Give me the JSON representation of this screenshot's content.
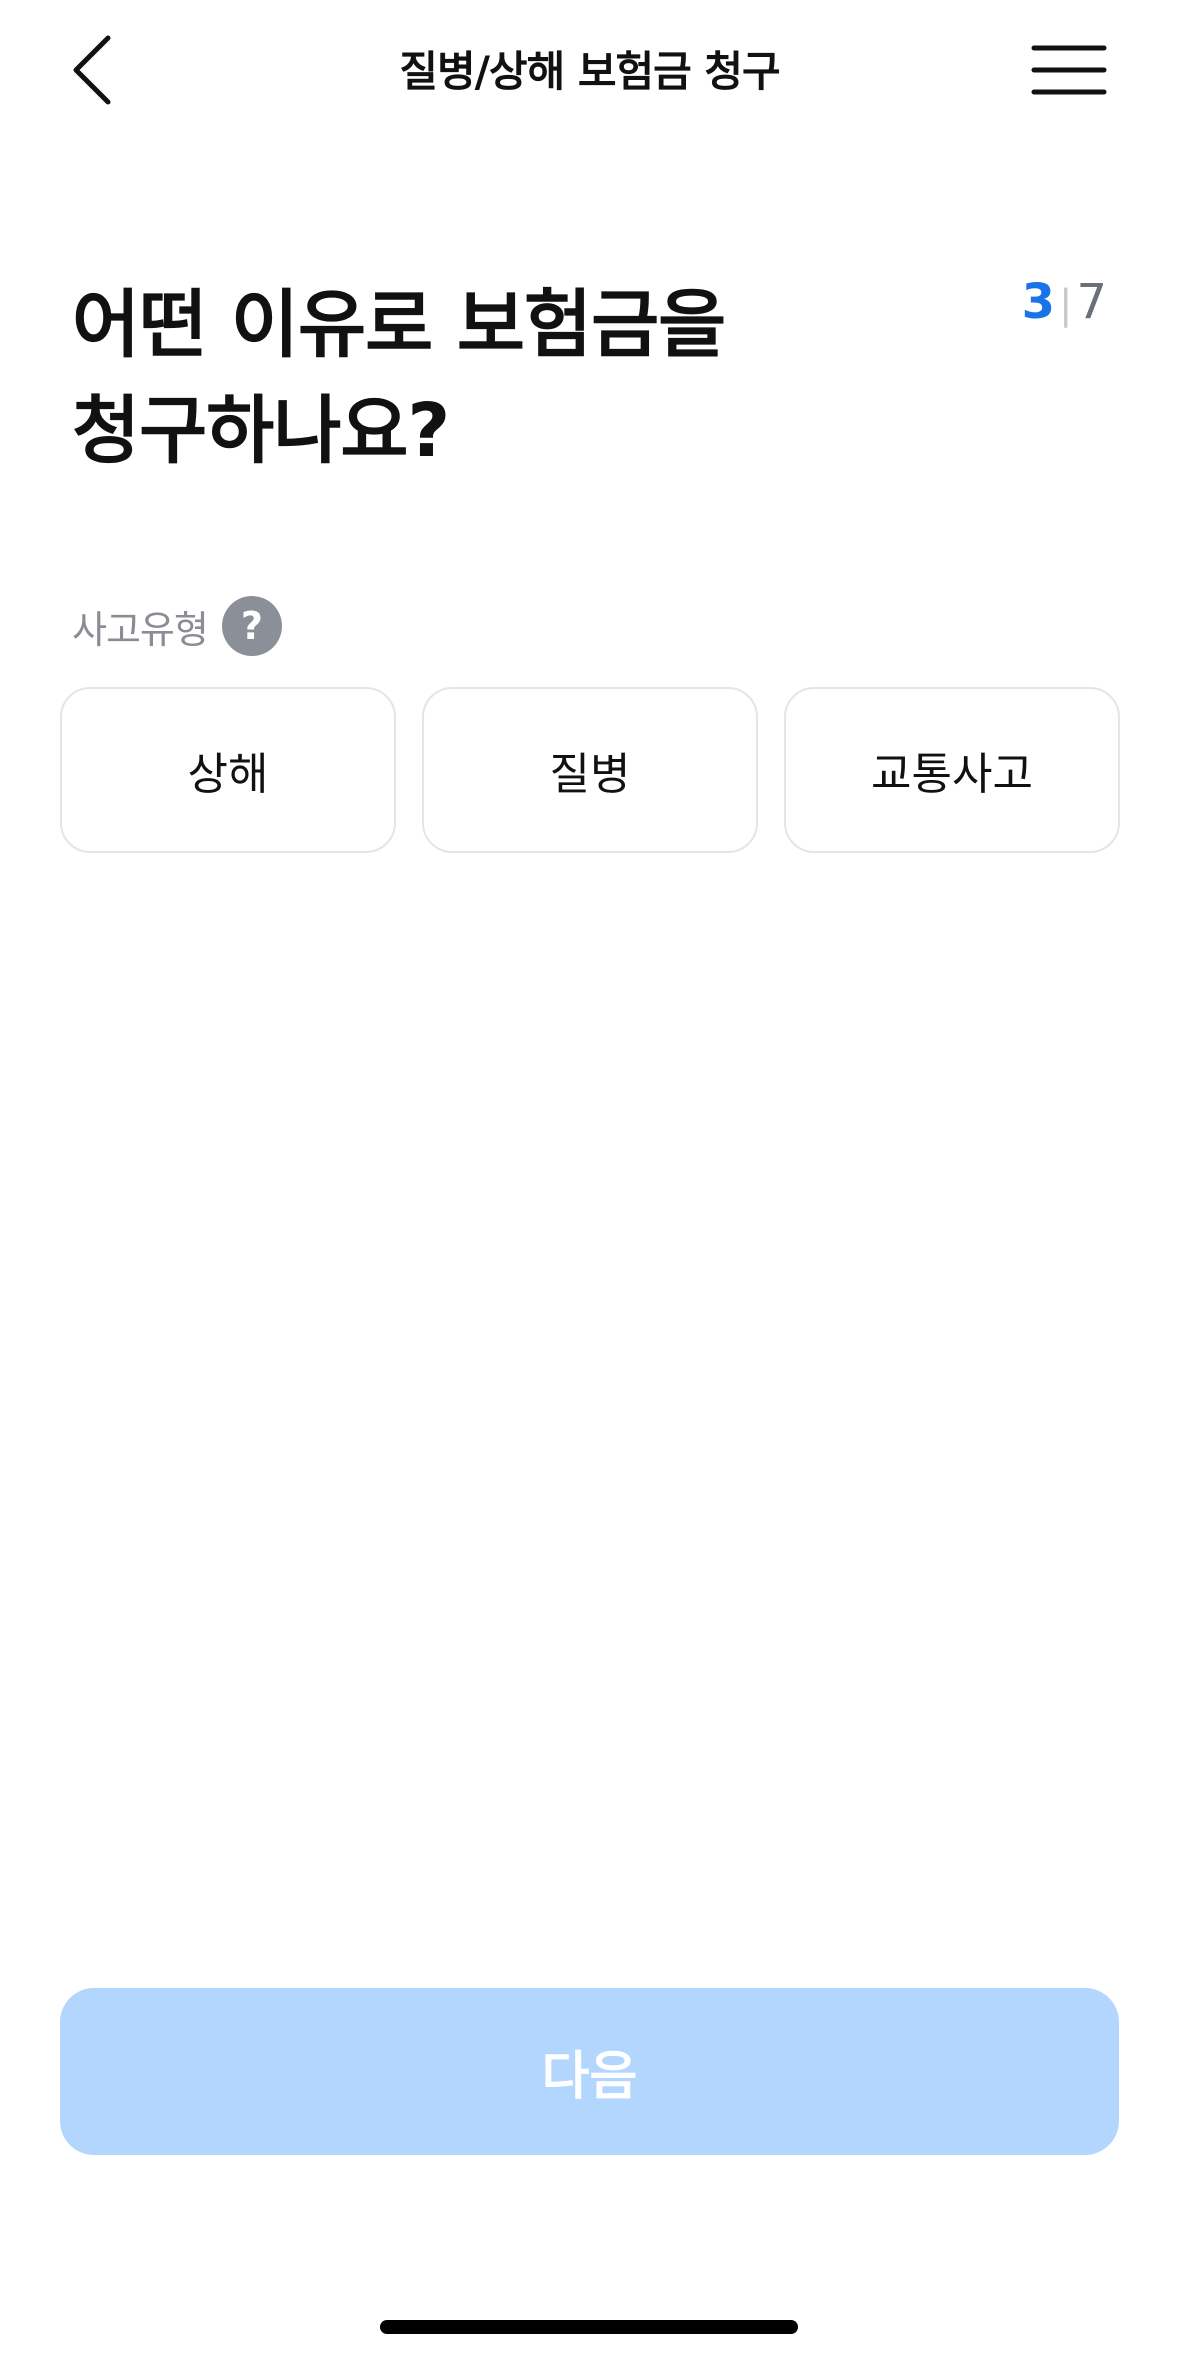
{
  "header": {
    "title": "질병/상해 보험금 청구",
    "back_icon": "chevron-left-icon",
    "menu_icon": "hamburger-menu-icon"
  },
  "question": {
    "line1": "어떤 이유로 보험금을",
    "line2": "청구하나요?"
  },
  "step": {
    "current": "3",
    "separator": "|",
    "total": "7",
    "current_color": "#1a73e8"
  },
  "section": {
    "label": "사고유형",
    "help_icon_text": "?"
  },
  "options": [
    {
      "label": "상해"
    },
    {
      "label": "질병"
    },
    {
      "label": "교통사고"
    }
  ],
  "footer": {
    "next_label": "다음",
    "next_color": "#b2d6fd"
  }
}
